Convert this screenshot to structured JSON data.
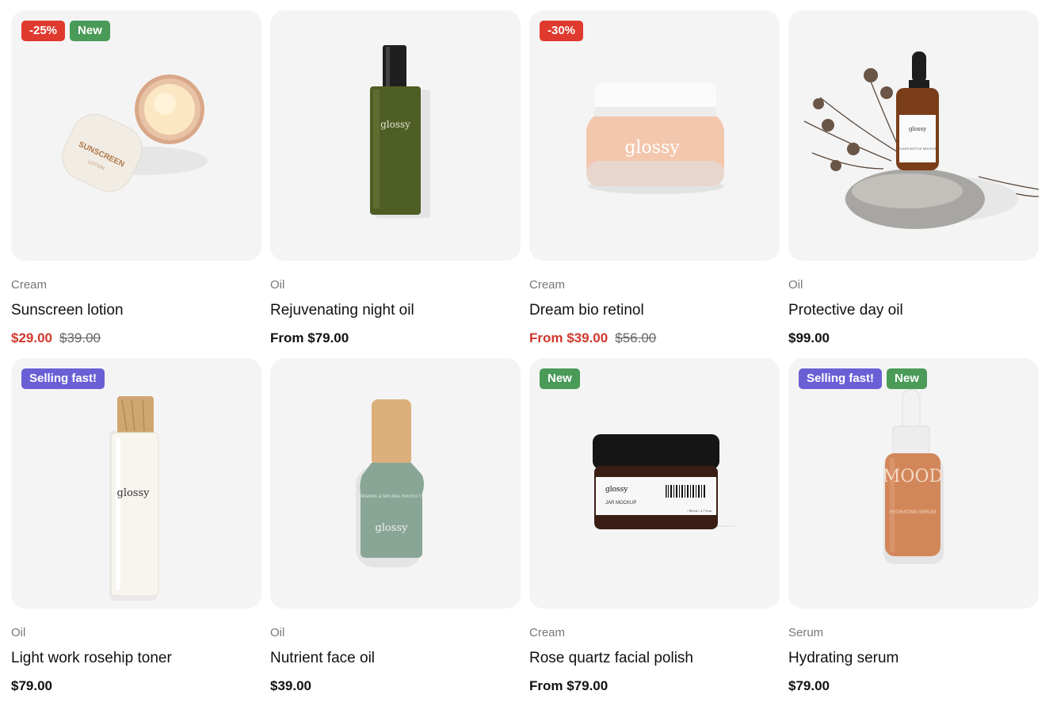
{
  "products": [
    {
      "category": "Cream",
      "title": "Sunscreen lotion",
      "price": "$29.00",
      "compare_price": "$39.00",
      "price_red": true,
      "badges": [
        {
          "text": "-25%",
          "kind": "sale"
        },
        {
          "text": "New",
          "kind": "new"
        }
      ],
      "image_icon": "cream-jar-open-icon",
      "image_text": {
        "a": "SUNSCREEN",
        "b": "LOTION"
      }
    },
    {
      "category": "Oil",
      "title": "Rejuvenating night oil",
      "price": "From $79.00",
      "compare_price": "",
      "price_red": false,
      "badges": [],
      "image_icon": "green-spray-bottle-icon",
      "image_text": {
        "a": "glossy",
        "b": ""
      }
    },
    {
      "category": "Cream",
      "title": "Dream bio retinol",
      "price": "From $39.00",
      "compare_price": "$56.00",
      "price_red": true,
      "badges": [
        {
          "text": "-30%",
          "kind": "sale"
        }
      ],
      "image_icon": "peach-cream-jar-icon",
      "image_text": {
        "a": "glossy",
        "b": ""
      }
    },
    {
      "category": "Oil",
      "title": "Protective day oil",
      "price": "$99.00",
      "compare_price": "",
      "price_red": false,
      "badges": [],
      "image_icon": "dropper-bottle-on-stone-icon",
      "image_text": {
        "a": "glossy",
        "b": "GLASS BOTTLE MOCKUP"
      }
    },
    {
      "category": "Oil",
      "title": "Light work rosehip toner",
      "price": "$79.00",
      "compare_price": "",
      "price_red": false,
      "badges": [
        {
          "text": "Selling fast!",
          "kind": "fast"
        }
      ],
      "image_icon": "clear-toner-bottle-icon",
      "image_text": {
        "a": "glossy",
        "b": ""
      }
    },
    {
      "category": "Oil",
      "title": "Nutrient face oil",
      "price": "$39.00",
      "compare_price": "",
      "price_red": false,
      "badges": [],
      "image_icon": "sage-pump-bottle-icon",
      "image_text": {
        "a": "glossy",
        "b": "ORGANIC & NATURAL PRODUCTS"
      }
    },
    {
      "category": "Cream",
      "title": "Rose quartz facial polish",
      "price": "From $79.00",
      "compare_price": "",
      "price_red": false,
      "badges": [
        {
          "text": "New",
          "kind": "new"
        }
      ],
      "image_icon": "black-lid-jar-icon",
      "image_text": {
        "a": "glossy",
        "b": "JAR MOCKUP",
        "c": "/ 50 mL / 1.7 fl oz"
      }
    },
    {
      "category": "Serum",
      "title": "Hydrating serum",
      "price": "$79.00",
      "compare_price": "",
      "price_red": false,
      "badges": [
        {
          "text": "Selling fast!",
          "kind": "fast"
        },
        {
          "text": "New",
          "kind": "new"
        }
      ],
      "image_icon": "orange-dropper-serum-icon",
      "image_text": {
        "a": "MOOD",
        "b": "HYDRATING SERUM"
      }
    }
  ],
  "colors": {
    "sale": "#e03a2f",
    "new": "#4a9a58",
    "fast": "#6b5fd6",
    "price_red": "#d0382c",
    "card_bg": "#f4f4f4"
  }
}
